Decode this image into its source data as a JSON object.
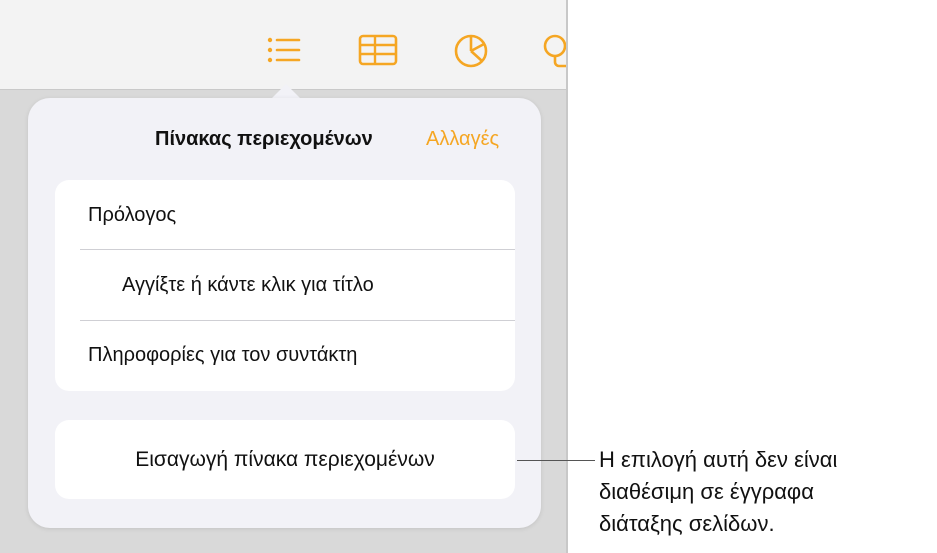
{
  "toolbar": {
    "icons": [
      "list-icon",
      "table-icon",
      "chart-icon",
      "shape-icon"
    ],
    "accent_color": "#f5a623"
  },
  "popover": {
    "title": "Πίνακας περιεχομένων",
    "action_label": "Αλλαγές",
    "items": [
      {
        "label": "Πρόλογος",
        "level": 1
      },
      {
        "label": "Αγγίξτε ή κάντε κλικ για τίτλο",
        "level": 2
      },
      {
        "label": "Πληροφορίες για τον συντάκτη",
        "level": 1
      }
    ],
    "insert_button_label": "Εισαγωγή πίνακα περιεχομένων"
  },
  "callout": {
    "lines": [
      "Η επιλογή αυτή δεν είναι",
      "διαθέσιμη σε έγγραφα",
      "διάταξης σελίδων."
    ]
  }
}
